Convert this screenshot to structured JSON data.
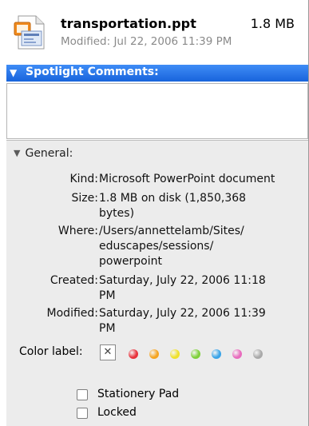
{
  "header": {
    "file_name": "transportation.ppt",
    "file_size": "1.8 MB",
    "modified": "Modified: Jul 22, 2006 11:39 PM",
    "icon": "powerpoint-file-icon"
  },
  "spotlight": {
    "label": "Spotlight Comments:",
    "comment": ""
  },
  "general": {
    "label": "General:",
    "kind_label": "Kind:",
    "kind_value": "Microsoft PowerPoint document",
    "size_label": "Size:",
    "size_value_1": "1.8 MB on disk (1,850,368",
    "size_value_2": "bytes)",
    "where_label": "Where:",
    "where_value_1": "/Users/annettelamb/Sites/",
    "where_value_2": "eduscapes/sessions/",
    "where_value_3": "powerpoint",
    "created_label": "Created:",
    "created_value_1": "Saturday, July 22, 2006 11:18",
    "created_value_2": "PM",
    "modified_label": "Modified:",
    "modified_value_1": "Saturday, July 22, 2006 11:39",
    "modified_value_2": "PM",
    "color_label": "Color label:",
    "color_none_glyph": "✕",
    "colors": [
      "#e8323c",
      "#f5a421",
      "#efe12b",
      "#7ed03a",
      "#3aa4e8",
      "#e86bbd",
      "#a9a9a9"
    ],
    "stationery_label": "Stationery Pad",
    "stationery_checked": false,
    "locked_label": "Locked",
    "locked_checked": false
  }
}
